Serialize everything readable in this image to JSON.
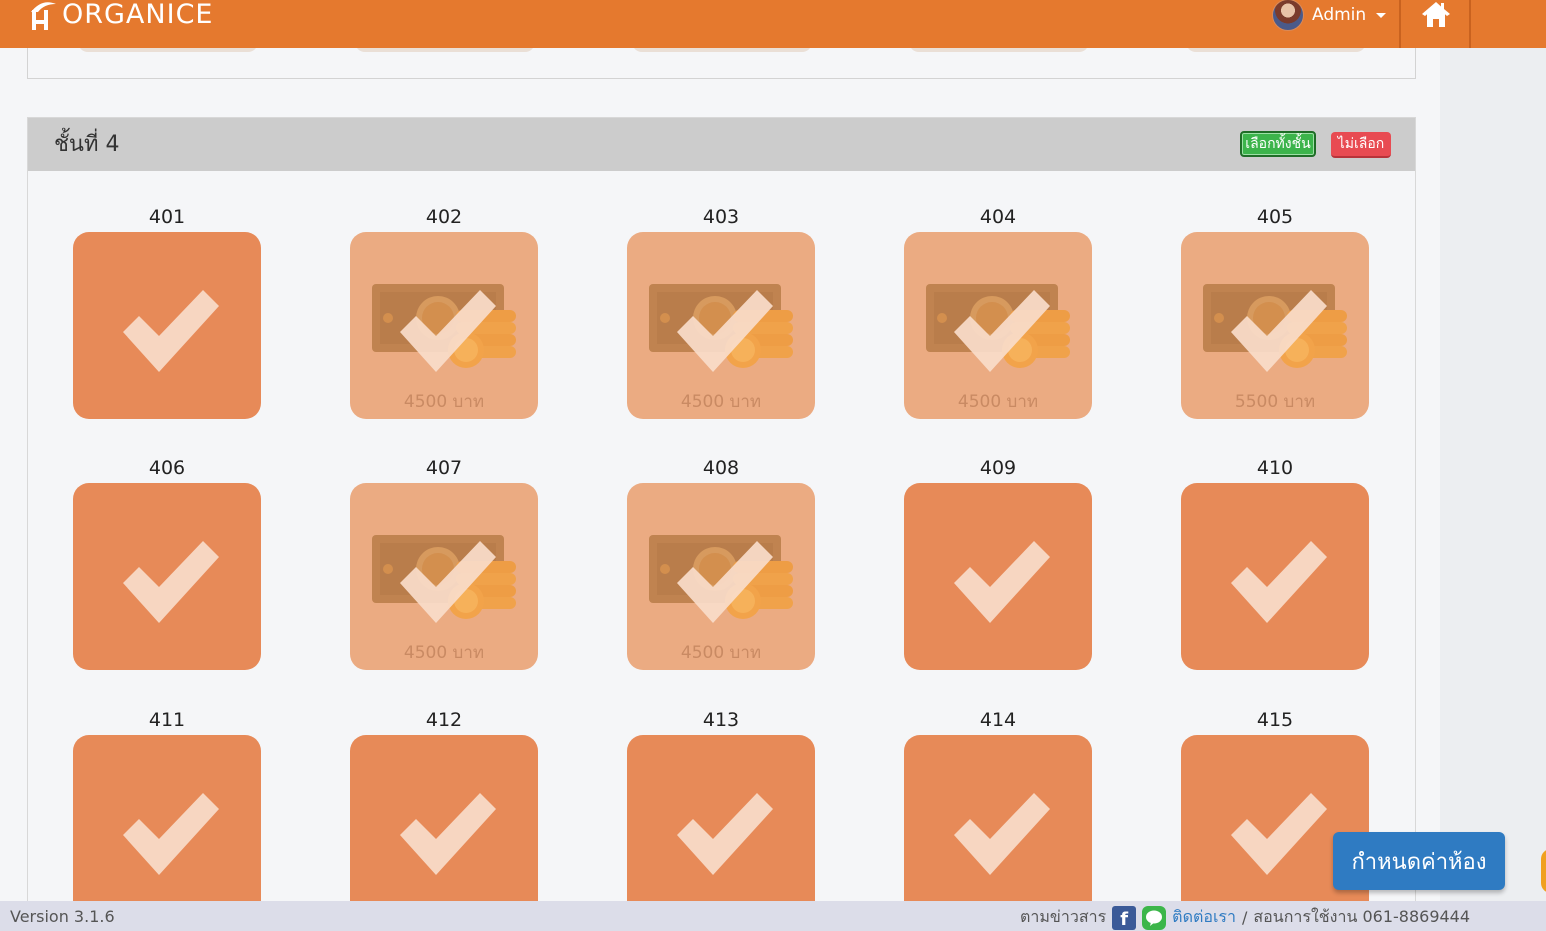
{
  "header": {
    "logo_text": "ORGANICE",
    "user_name": "Admin"
  },
  "floor": {
    "title": "ชั้นที่ 4",
    "select_all_label": "เลือกทั้งชั้น",
    "select_none_label": "ไม่เลือก"
  },
  "rooms": [
    {
      "number": "401",
      "state": "selected",
      "price": ""
    },
    {
      "number": "402",
      "state": "paid",
      "price": "4500 บาท"
    },
    {
      "number": "403",
      "state": "paid",
      "price": "4500 บาท"
    },
    {
      "number": "404",
      "state": "paid",
      "price": "4500 บาท"
    },
    {
      "number": "405",
      "state": "paid",
      "price": "5500 บาท"
    },
    {
      "number": "406",
      "state": "selected",
      "price": ""
    },
    {
      "number": "407",
      "state": "paid",
      "price": "4500 บาท"
    },
    {
      "number": "408",
      "state": "paid",
      "price": "4500 บาท"
    },
    {
      "number": "409",
      "state": "selected",
      "price": ""
    },
    {
      "number": "410",
      "state": "selected",
      "price": ""
    },
    {
      "number": "411",
      "state": "selected",
      "price": ""
    },
    {
      "number": "412",
      "state": "selected",
      "price": ""
    },
    {
      "number": "413",
      "state": "selected",
      "price": ""
    },
    {
      "number": "414",
      "state": "selected",
      "price": ""
    },
    {
      "number": "415",
      "state": "selected",
      "price": ""
    }
  ],
  "actions": {
    "configure_rooms_label": "กำหนดค่าห้อง"
  },
  "footer": {
    "version": "Version 3.1.6",
    "news_label": "ตามข่าวสาร",
    "contact_label": "ติดต่อเรา",
    "separator": "/",
    "tutorial_label": "สอนการใช้งาน 061-8869444"
  },
  "colors": {
    "brand": "#e5792e",
    "tile_selected": "#e78a58",
    "tile_paid": "#ebab82",
    "select_all": "#3cb44b",
    "select_none": "#e84b52",
    "config_button": "#2f7bc2"
  }
}
